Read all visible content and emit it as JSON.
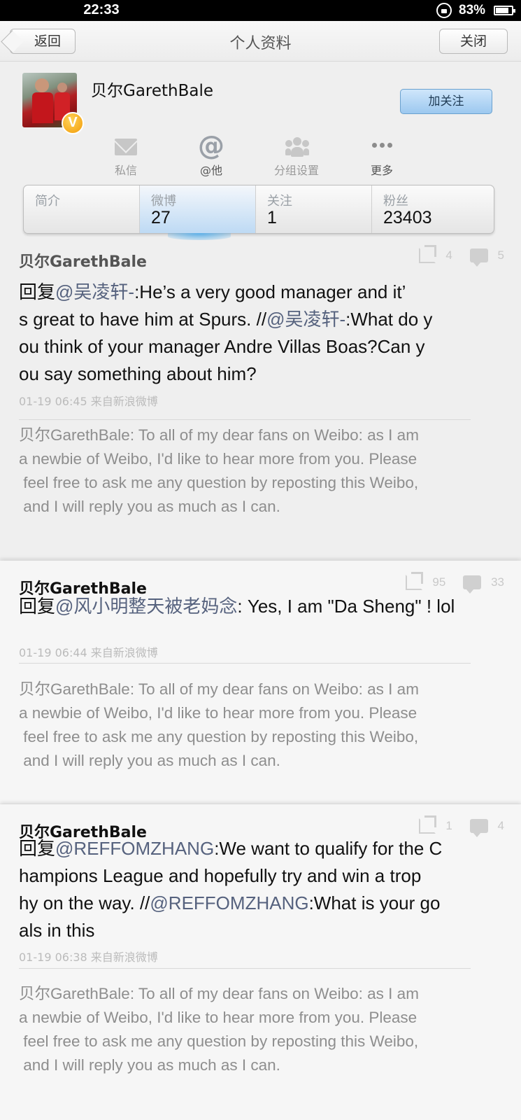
{
  "status_bar": {
    "time": "22:33",
    "battery_percent": "83%",
    "battery_level": 0.83
  },
  "nav": {
    "back_label": "返回",
    "title": "个人资料",
    "close_label": "关闭"
  },
  "profile": {
    "name": "贝尔GarethBale",
    "verified_mark": "V",
    "follow_label": "加关注"
  },
  "actions": [
    {
      "label": "私信",
      "icon": "mail-icon"
    },
    {
      "label": "@他",
      "icon": "at-icon",
      "glyph": "@"
    },
    {
      "label": "分组设置",
      "icon": "group-icon"
    },
    {
      "label": "更多",
      "icon": "more-icon"
    }
  ],
  "stats": [
    {
      "label": "简介",
      "value": ""
    },
    {
      "label": "微博",
      "value": "27"
    },
    {
      "label": "关注",
      "value": "1"
    },
    {
      "label": "粉丝",
      "value": "23403"
    }
  ],
  "posts": [
    {
      "author": "贝尔GarethBale",
      "reposts": "4",
      "comments": "5",
      "body_lines": [
        [
          {
            "t": "回复"
          },
          {
            "t": "@吴凌轩-",
            "m": true
          },
          {
            "t": ":He’s a very good manager and it’"
          }
        ],
        [
          {
            "t": "s great to have him at Spurs. //"
          },
          {
            "t": "@吴凌轩-",
            "m": true
          },
          {
            "t": ":What do y"
          }
        ],
        [
          {
            "t": "ou think of your manager Andre Villas Boas?Can y"
          }
        ],
        [
          {
            "t": "ou say something about him?"
          }
        ]
      ],
      "meta": "01-19 06:45 来自新浪微博",
      "orig_lines": [
        "贝尔GarethBale: To all of my dear fans on Weibo: as I am",
        "a newbie of Weibo, I'd like to hear more from you. Please",
        " feel free to ask me any question by reposting this Weibo,",
        " and I will reply you as much as I can."
      ]
    },
    {
      "author": "贝尔GarethBale",
      "reposts": "95",
      "comments": "33",
      "body_lines": [
        [
          {
            "t": "回复"
          },
          {
            "t": "@风小明整天被老妈念",
            "m": true
          },
          {
            "t": ": Yes, I am \"Da Sheng\" ! lol"
          }
        ]
      ],
      "meta": "01-19 06:44 来自新浪微博",
      "orig_lines": [
        "贝尔GarethBale: To all of my dear fans on Weibo: as I am",
        "a newbie of Weibo, I'd like to hear more from you. Please",
        " feel free to ask me any question by reposting this Weibo,",
        " and I will reply you as much as I can."
      ]
    },
    {
      "author": "贝尔GarethBale",
      "reposts": "1",
      "comments": "4",
      "body_lines": [
        [
          {
            "t": "回复"
          },
          {
            "t": "@REFFOMZHANG",
            "m": true
          },
          {
            "t": ":We want to qualify for the C"
          }
        ],
        [
          {
            "t": "hampions League and hopefully try and win a trop"
          }
        ],
        [
          {
            "t": "hy on the way. //"
          },
          {
            "t": "@REFFOMZHANG",
            "m": true
          },
          {
            "t": ":What is your go"
          }
        ],
        [
          {
            "t": "als in this"
          }
        ]
      ],
      "meta": "01-19 06:38 来自新浪微博",
      "orig_lines": [
        "贝尔GarethBale: To all of my dear fans on Weibo: as I am",
        "a newbie of Weibo, I'd like to hear more from you. Please",
        " feel free to ask me any question by reposting this Weibo,",
        " and I will reply you as much as I can."
      ]
    }
  ],
  "colors": {
    "mention": "#56627e",
    "follow_button": "#9cc8ef",
    "verified_badge": "#f29b06"
  }
}
